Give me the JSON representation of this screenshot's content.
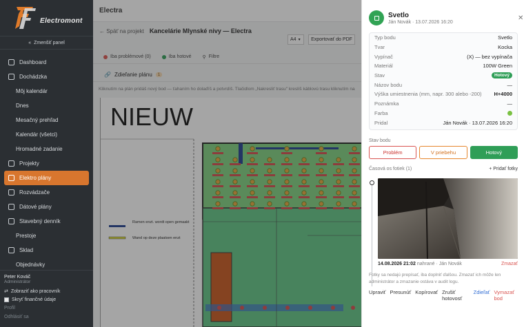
{
  "brand": {
    "logo_text": "Electromont"
  },
  "sidebar": {
    "collapse_label": "Zmenšiť panel",
    "items": [
      {
        "label": "Dashboard",
        "icon": "home-icon",
        "sub": false,
        "active": false
      },
      {
        "label": "Dochádzka",
        "icon": "clock-icon",
        "sub": false,
        "active": false
      },
      {
        "label": "Môj kalendár",
        "icon": "",
        "sub": true,
        "active": false
      },
      {
        "label": "Dnes",
        "icon": "",
        "sub": true,
        "active": false
      },
      {
        "label": "Mesačný prehľad",
        "icon": "",
        "sub": true,
        "active": false
      },
      {
        "label": "Kalendár (všetci)",
        "icon": "",
        "sub": true,
        "active": false
      },
      {
        "label": "Hromadné zadanie",
        "icon": "",
        "sub": true,
        "active": false
      },
      {
        "label": "Projekty",
        "icon": "folder-icon",
        "sub": false,
        "active": false
      },
      {
        "label": "Elektro plány",
        "icon": "plan-icon",
        "sub": false,
        "active": true
      },
      {
        "label": "Rozvádzače",
        "icon": "box-icon",
        "sub": false,
        "active": false
      },
      {
        "label": "Dátové plány",
        "icon": "data-icon",
        "sub": false,
        "active": false
      },
      {
        "label": "Stavebný denník",
        "icon": "book-icon",
        "sub": false,
        "active": false
      },
      {
        "label": "Prestoje",
        "icon": "",
        "sub": true,
        "active": false
      },
      {
        "label": "Sklad",
        "icon": "warehouse-icon",
        "sub": false,
        "active": false
      },
      {
        "label": "Objednávky",
        "icon": "",
        "sub": true,
        "active": false
      }
    ],
    "user": {
      "name": "Peter Kováč",
      "role": "Administrátor",
      "view_as_worker": "Zobraziť ako pracovník",
      "hide_finance": "Skryť finančné údaje",
      "profile": "Profil",
      "logout": "Odhlásiť sa"
    }
  },
  "main": {
    "app_title": "Electra",
    "back_label": "← Späť na projekt",
    "plan_title": "Kancelárie Mlynské nivy — Electra",
    "paper_size": "A4",
    "export_label": "Exportovať do PDF",
    "chips": [
      {
        "label": "Iba problémové (0)",
        "color": "#d9534f"
      },
      {
        "label": "Iba hotové",
        "color": "#2f9e57"
      },
      {
        "label": "Filtre",
        "color": ""
      }
    ],
    "tab_label": "Zdieľanie plánu",
    "tab_count": "1",
    "hint": "Kliknutím na plán pridáš nový bod — ťahaním ho dolaďíš a potvrdíš. Tlačidlom „Nakresliť trasu\" kreslíš káblovú trasu kliknutím na",
    "plan": {
      "heading": "NIEUW",
      "legend_1": "Ramen enzt. wordt open gemaakt",
      "legend_2": "Wand op deze plaatsen enzt"
    }
  },
  "panel": {
    "title": "Svetlo",
    "subtitle": "Ján Novák · 13.07.2026 16:20",
    "info": [
      {
        "label": "Typ bodu",
        "value": "Svetlo"
      },
      {
        "label": "Tvar",
        "value": "Kocka"
      },
      {
        "label": "Vypínač",
        "value": "(X) — bez vypínača"
      },
      {
        "label": "Materiál",
        "value": "100W Green"
      },
      {
        "label": "Stav",
        "value": "Hotový"
      },
      {
        "label": "Názov bodu",
        "value": "—"
      },
      {
        "label": "Výška umiestnenia (mm, napr. 300 alebo -200)",
        "value": "H+4000"
      },
      {
        "label": "Poznámka",
        "value": "—"
      },
      {
        "label": "Farba",
        "value": ""
      },
      {
        "label": "Pridal",
        "value": "Ján Novák · 13.07.2026 16:20"
      }
    ],
    "color_value": "#7ac142",
    "status_section": "Stav bodu",
    "status_buttons": {
      "problem": "Problém",
      "progress": "V priebehu",
      "done": "Hotový"
    },
    "timeline_title": "Časová os fotiek (1)",
    "add_photo": "+ Pridať fotky",
    "photo": {
      "date": "14.08.2026 21:02",
      "by": "nahrané · Ján Novák",
      "delete": "Zmazať"
    },
    "note": "Fotky sa nedajú prepísať, iba doplniť ďalšou. Zmazať ich môže len administrátor a zmazanie ostáva v audit logu.",
    "actions": {
      "edit": "Upraviť",
      "move": "Presunúť",
      "copy": "Kopírovať",
      "cancel_done": "Zrušiť hotovosť",
      "share": "Zdieľať",
      "delete": "Vymazať bod"
    }
  }
}
